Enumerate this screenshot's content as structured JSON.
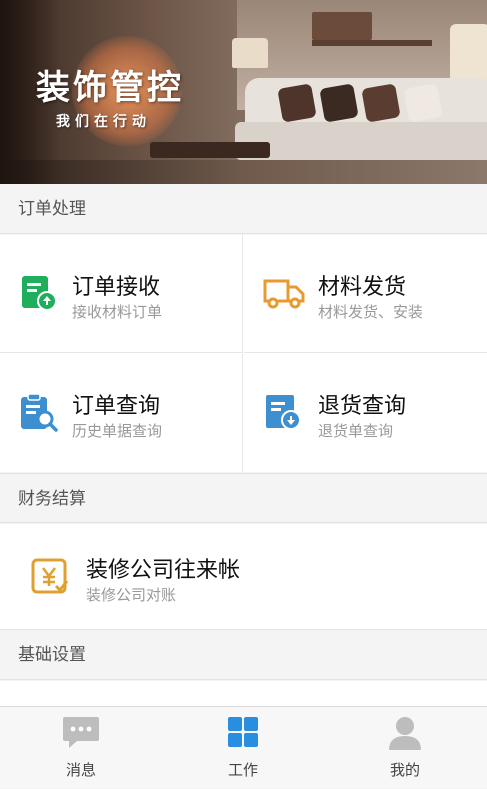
{
  "banner": {
    "title": "装饰管控",
    "subtitle": "我们在行动"
  },
  "sections": {
    "order": {
      "header": "订单处理"
    },
    "finance": {
      "header": "财务结算"
    },
    "settings": {
      "header": "基础设置"
    }
  },
  "order_items": [
    {
      "title": "订单接收",
      "desc": "接收材料订单",
      "icon": "order-receive-icon",
      "color": "#1fae5b"
    },
    {
      "title": "材料发货",
      "desc": "材料发货、安装",
      "icon": "delivery-truck-icon",
      "color": "#e79a2f"
    },
    {
      "title": "订单查询",
      "desc": "历史单据查询",
      "icon": "clipboard-search-icon",
      "color": "#3d8fd0"
    },
    {
      "title": "退货查询",
      "desc": "退货单查询",
      "icon": "return-document-icon",
      "color": "#3d8fd0"
    }
  ],
  "finance_items": [
    {
      "title": "装修公司往来帐",
      "desc": "装修公司对账",
      "icon": "yuan-document-icon",
      "color": "#e0a030"
    }
  ],
  "tabs": [
    {
      "label": "消息",
      "icon": "message-icon",
      "active": false
    },
    {
      "label": "工作",
      "icon": "grid-icon",
      "active": true
    },
    {
      "label": "我的",
      "icon": "user-icon",
      "active": false
    }
  ],
  "colors": {
    "active_tab": "#2a8ee0",
    "inactive_tab": "#bdbdbd"
  }
}
